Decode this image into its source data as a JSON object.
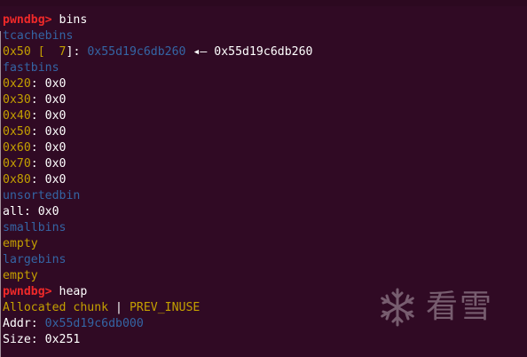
{
  "terminal": {
    "prompt": "pwndbg>",
    "cmd_bins": "bins",
    "tcache_title": "tcachebins",
    "tcache_size": "0x50",
    "tcache_open": "[",
    "tcache_count": "  7",
    "tcache_close": "]:",
    "tcache_ptr": "0x55d19c6db260",
    "tcache_arrow": "◂—",
    "tcache_next": "0x55d19c6db260",
    "fastbins_title": "fastbins",
    "fastbins": [
      {
        "size": "0x20",
        "value": "0x0"
      },
      {
        "size": "0x30",
        "value": "0x0"
      },
      {
        "size": "0x40",
        "value": "0x0"
      },
      {
        "size": "0x50",
        "value": "0x0"
      },
      {
        "size": "0x60",
        "value": "0x0"
      },
      {
        "size": "0x70",
        "value": "0x0"
      },
      {
        "size": "0x80",
        "value": "0x0"
      }
    ],
    "unsorted_title": "unsortedbin",
    "unsorted_label": "all",
    "unsorted_value": "0x0",
    "smallbins_title": "smallbins",
    "smallbins_value": "empty",
    "largebins_title": "largebins",
    "largebins_value": "empty",
    "cmd_heap": "heap",
    "chunk_type": "Allocated chunk",
    "chunk_sep": "|",
    "chunk_flag": "PREV_INUSE",
    "addr_label": "Addr:",
    "addr_value": "0x55d19c6db000",
    "size_label": "Size:",
    "size_value": "0x251"
  },
  "watermark": {
    "text": "看雪",
    "icon": "snowflake-icon"
  },
  "colors": {
    "background": "#300a24",
    "prompt": "#ef2929",
    "title": "#3465a4",
    "size": "#c4a000"
  }
}
